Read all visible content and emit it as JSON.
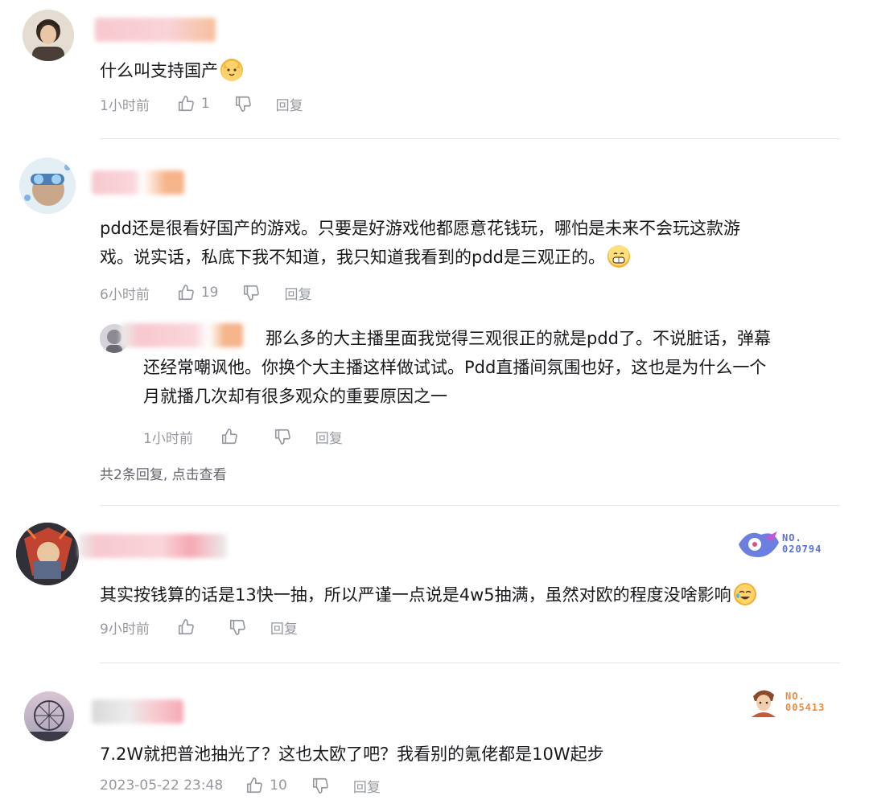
{
  "colors": {
    "meta_text": "#9499a0",
    "divider": "#e3e5e7",
    "badge_blue": "#5b6fd8",
    "badge_orange": "#f08a3c",
    "name_blur_pink": "#f7c8cf",
    "name_blur_orange": "#f5b48a"
  },
  "comments": [
    {
      "content": "什么叫支持国产",
      "emoji": "cat-face-emoji",
      "time": "1小时前",
      "likes": "1",
      "reply_label": "回复"
    },
    {
      "content_line1": "pdd还是很看好国产的游戏。只要是好游戏他都愿意花钱玩，哪怕是未来不会玩这款游",
      "content_line2": "戏。说实话，私底下我不知道，我只知道我看到的pdd是三观正的。",
      "emoji": "grin-emoji",
      "time": "6小时前",
      "likes": "19",
      "reply_label": "回复",
      "sub_reply": {
        "line1": "那么多的大主播里面我觉得三观很正的就是pdd了。不说脏话，弹幕",
        "line2": "还经常嘲讽他。你换个大主播这样做试试。Pdd直播间氛围也好，这也是为什么一个",
        "line3": "月就播几次却有很多观众的重要原因之一",
        "time": "1小时前",
        "reply_label": "回复"
      },
      "view_more": "共2条回复, 点击查看"
    },
    {
      "content": "其实按钱算的话是13快一抽，所以严谨一点说是4w5抽满，虽然对欧的程度没啥影响",
      "emoji": "laugh-cry-emoji",
      "badge": "NO.\n020794",
      "badge_line1": "NO.",
      "badge_line2": "020794",
      "time": "9小时前",
      "reply_label": "回复"
    },
    {
      "content": "7.2W就把普池抽光了？这也太欧了吧？我看别的氪佬都是10W起步",
      "badge_line1": "NO.",
      "badge_line2": "005413",
      "time": "2023-05-22 23:48",
      "likes": "10",
      "reply_label": "回复"
    }
  ]
}
